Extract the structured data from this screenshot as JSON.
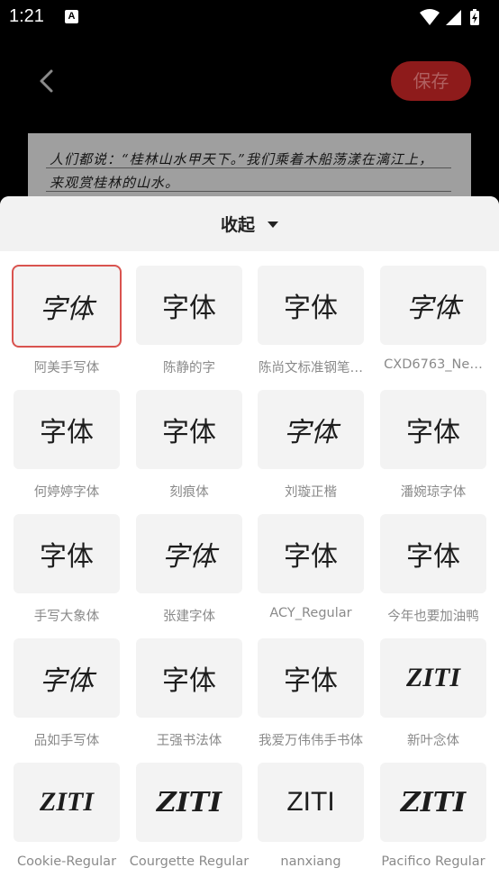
{
  "status_bar": {
    "time": "1:21",
    "notification_badge": "A"
  },
  "editor": {
    "save_label": "保存",
    "document_lines": [
      "人们都说：“桂林山水甲天下。”我们乘着木船荡漾在漓江上，",
      "来观赏桂林的山水。"
    ]
  },
  "sheet": {
    "collapse_label": "收起"
  },
  "fonts": [
    {
      "name": "阿美手写体",
      "preview": "字体",
      "selected": true
    },
    {
      "name": "陈静的字",
      "preview": "字体"
    },
    {
      "name": "陈尚文标准钢笔…",
      "preview": "字体"
    },
    {
      "name": "CXD6763_Ne…",
      "preview": "字体"
    },
    {
      "name": "何婷婷字体",
      "preview": "字体"
    },
    {
      "name": "刻痕体",
      "preview": "字体"
    },
    {
      "name": "刘璇正楷",
      "preview": "字体"
    },
    {
      "name": "潘婉琼字体",
      "preview": "字体"
    },
    {
      "name": "手写大象体",
      "preview": "字体"
    },
    {
      "name": "张建字体",
      "preview": "字体"
    },
    {
      "name": "ACY_Regular",
      "preview": "字体"
    },
    {
      "name": "今年也要加油鸭",
      "preview": "字体"
    },
    {
      "name": "品如手写体",
      "preview": "字体"
    },
    {
      "name": "王强书法体",
      "preview": "字体"
    },
    {
      "name": "我爱万伟伟手书体",
      "preview": "字体"
    },
    {
      "name": "新叶念体",
      "preview": "ZITI"
    },
    {
      "name": "Cookie-Regular",
      "preview": "ZITI"
    },
    {
      "name": "Courgette Regular",
      "preview": "ZITI"
    },
    {
      "name": "nanxiang",
      "preview": "ZITI"
    },
    {
      "name": "Pacifico Regular",
      "preview": "ZITI"
    }
  ],
  "colors": {
    "accent": "#d9534f",
    "save_button_bg": "#8e1b1b",
    "tile_bg": "#f3f3f3",
    "sheet_header_bg": "#f2f2f2"
  }
}
